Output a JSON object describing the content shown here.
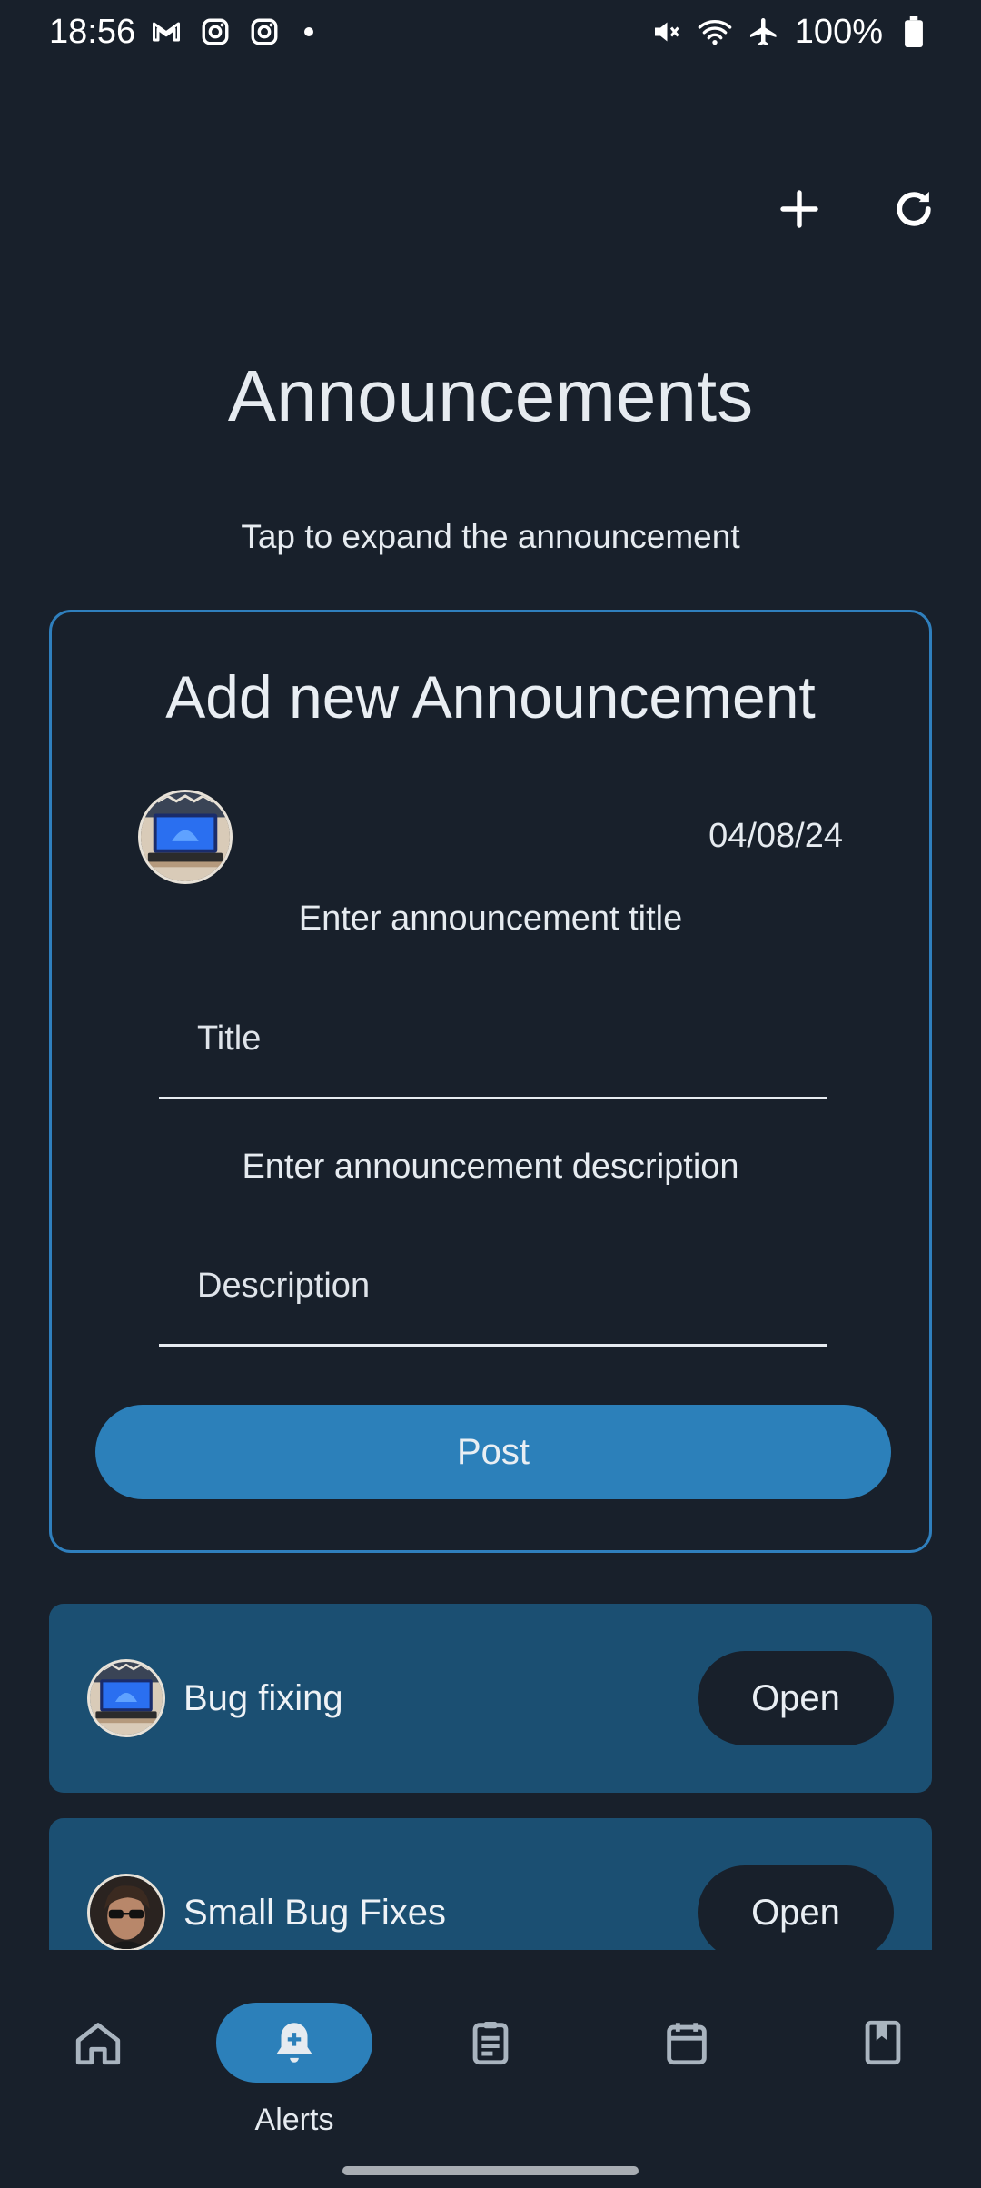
{
  "status_bar": {
    "time": "18:56",
    "battery": "100%",
    "icons_left": [
      "gmail-icon",
      "instagram-icon",
      "instagram-icon",
      "dot-icon"
    ],
    "icons_right": [
      "mute-icon",
      "wifi-icon",
      "airplane-icon",
      "battery-icon"
    ]
  },
  "header": {
    "title": "Announcements",
    "subtitle": "Tap to expand the announcement",
    "add_icon": "plus-icon",
    "refresh_icon": "refresh-icon"
  },
  "add_card": {
    "title": "Add new Announcement",
    "date": "04/08/24",
    "title_caption": "Enter announcement title",
    "title_placeholder": "Title",
    "desc_caption": "Enter announcement description",
    "desc_placeholder": "Description",
    "post_label": "Post"
  },
  "announcements": [
    {
      "title": "Bug fixing",
      "open_label": "Open",
      "avatar": "laptop-avatar"
    },
    {
      "title": "Small Bug Fixes",
      "open_label": "Open",
      "avatar": "person-avatar"
    }
  ],
  "bottom_nav": {
    "items": [
      {
        "icon": "home-icon",
        "label": ""
      },
      {
        "icon": "bell-plus-icon",
        "label": "Alerts",
        "active": true
      },
      {
        "icon": "clipboard-icon",
        "label": ""
      },
      {
        "icon": "calendar-icon",
        "label": ""
      },
      {
        "icon": "bookmark-book-icon",
        "label": ""
      }
    ]
  },
  "colors": {
    "background": "#18202b",
    "accent": "#2c80ba",
    "card_item": "#1b4f72",
    "outline": "#2f7fbd"
  }
}
